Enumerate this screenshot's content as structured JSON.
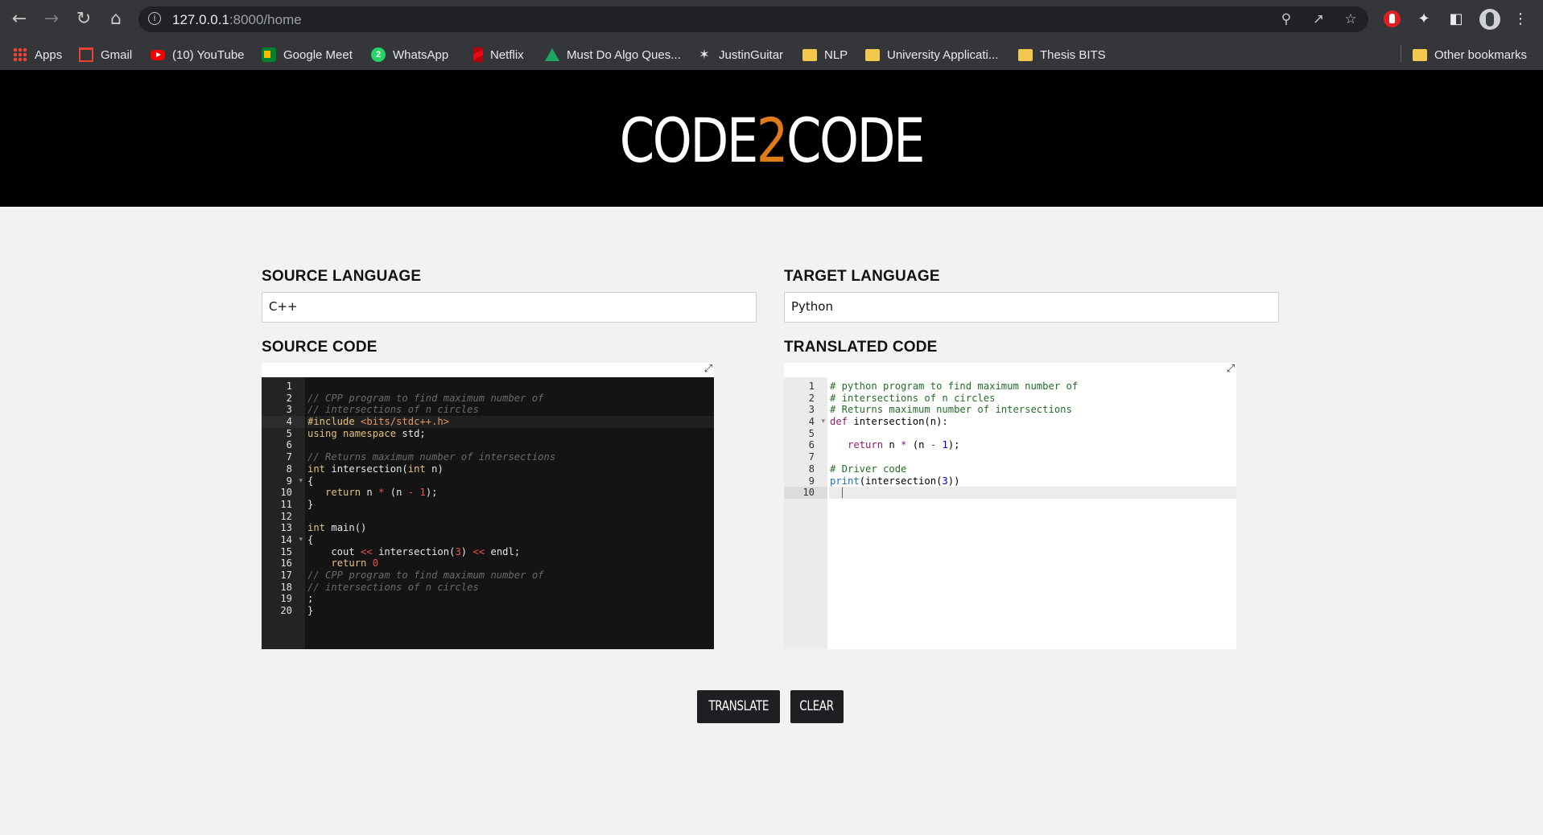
{
  "browser": {
    "url_host": "127.0.0.1",
    "url_path": ":8000/home",
    "bookmarks": [
      {
        "label": "Apps",
        "icon": "apps-grid-icon"
      },
      {
        "label": "Gmail",
        "icon": "gmail-icon"
      },
      {
        "label": "(10) YouTube",
        "icon": "youtube-icon"
      },
      {
        "label": "Google Meet",
        "icon": "google-meet-icon"
      },
      {
        "label": "WhatsApp",
        "icon": "whatsapp-icon"
      },
      {
        "label": "Netflix",
        "icon": "netflix-icon"
      },
      {
        "label": "Must Do Algo Ques...",
        "icon": "google-drive-icon"
      },
      {
        "label": "JustinGuitar",
        "icon": "justinguitar-icon"
      },
      {
        "label": "NLP",
        "icon": "folder-icon"
      },
      {
        "label": "University Applicati...",
        "icon": "folder-icon"
      },
      {
        "label": "Thesis BITS",
        "icon": "folder-icon"
      }
    ],
    "other_bookmarks": "Other bookmarks",
    "whatsapp_badge": "2"
  },
  "app": {
    "logo_left": "CODE",
    "logo_mid": "2",
    "logo_right": "CODE",
    "accent_color": "#e07b1a"
  },
  "form": {
    "source_language_label": "SOURCE LANGUAGE",
    "source_language_value": "C++",
    "target_language_label": "TARGET LANGUAGE",
    "target_language_value": "Python",
    "source_code_label": "SOURCE CODE",
    "translated_code_label": "TRANSLATED CODE",
    "translate_button": "TRANSLATE",
    "clear_button": "CLEAR"
  },
  "source_code": {
    "line_numbers": [
      "1",
      "2",
      "3",
      "4",
      "5",
      "6",
      "7",
      "8",
      "9",
      "10",
      "11",
      "12",
      "13",
      "14",
      "15",
      "16",
      "17",
      "18",
      "19",
      "20"
    ],
    "lines": [
      [],
      [
        [
          "cm",
          "// CPP program to find maximum number of"
        ]
      ],
      [
        [
          "cm",
          "// intersections of n circles"
        ]
      ],
      [
        [
          "kw",
          "#include "
        ],
        [
          "str",
          "<bits/stdc++.h>"
        ]
      ],
      [
        [
          "kw",
          "using namespace "
        ],
        [
          "",
          "std;"
        ]
      ],
      [],
      [
        [
          "cm",
          "// Returns maximum number of intersections"
        ]
      ],
      [
        [
          "kw",
          "int "
        ],
        [
          "",
          "intersection("
        ],
        [
          "kw",
          "int "
        ],
        [
          "",
          "n)"
        ]
      ],
      [
        [
          "",
          "{"
        ]
      ],
      [
        [
          "",
          "   "
        ],
        [
          "kw",
          "return "
        ],
        [
          "",
          "n "
        ],
        [
          "op",
          "* "
        ],
        [
          "",
          "(n "
        ],
        [
          "op",
          "- "
        ],
        [
          "num",
          "1"
        ],
        [
          "",
          ");"
        ]
      ],
      [
        [
          "",
          "}"
        ]
      ],
      [],
      [
        [
          "kw",
          "int "
        ],
        [
          "",
          "main()"
        ]
      ],
      [
        [
          "",
          "{"
        ]
      ],
      [
        [
          "",
          "    cout "
        ],
        [
          "op",
          "<< "
        ],
        [
          "",
          "intersection("
        ],
        [
          "num",
          "3"
        ],
        [
          "",
          ") "
        ],
        [
          "op",
          "<< "
        ],
        [
          "",
          "endl;"
        ]
      ],
      [
        [
          "",
          "    "
        ],
        [
          "kw",
          "return "
        ],
        [
          "num",
          "0"
        ]
      ],
      [
        [
          "cm",
          "// CPP program to find maximum number of"
        ]
      ],
      [
        [
          "cm",
          "// intersections of n circles"
        ]
      ],
      [
        [
          "",
          ";"
        ]
      ],
      [
        [
          "",
          "}"
        ]
      ]
    ]
  },
  "translated_code": {
    "line_numbers": [
      "1",
      "2",
      "3",
      "4",
      "5",
      "6",
      "7",
      "8",
      "9",
      "10"
    ],
    "lines": [
      [
        [
          "cm",
          "# python program to find maximum number of"
        ]
      ],
      [
        [
          "cm",
          "# intersections of n circles"
        ]
      ],
      [
        [
          "cm",
          "# Returns maximum number of intersections"
        ]
      ],
      [
        [
          "kw",
          "def "
        ],
        [
          "",
          "intersection(n):"
        ]
      ],
      [],
      [
        [
          "",
          "   "
        ],
        [
          "kw",
          "return "
        ],
        [
          "",
          "n "
        ],
        [
          "kw",
          "* "
        ],
        [
          "",
          "(n "
        ],
        [
          "kw",
          "- "
        ],
        [
          "num",
          "1"
        ],
        [
          "",
          ");"
        ]
      ],
      [],
      [
        [
          "cm",
          "# Driver code"
        ]
      ],
      [
        [
          "fn",
          "print"
        ],
        [
          "",
          "(intersection("
        ],
        [
          "num",
          "3"
        ],
        [
          "",
          "))"
        ]
      ],
      []
    ]
  }
}
